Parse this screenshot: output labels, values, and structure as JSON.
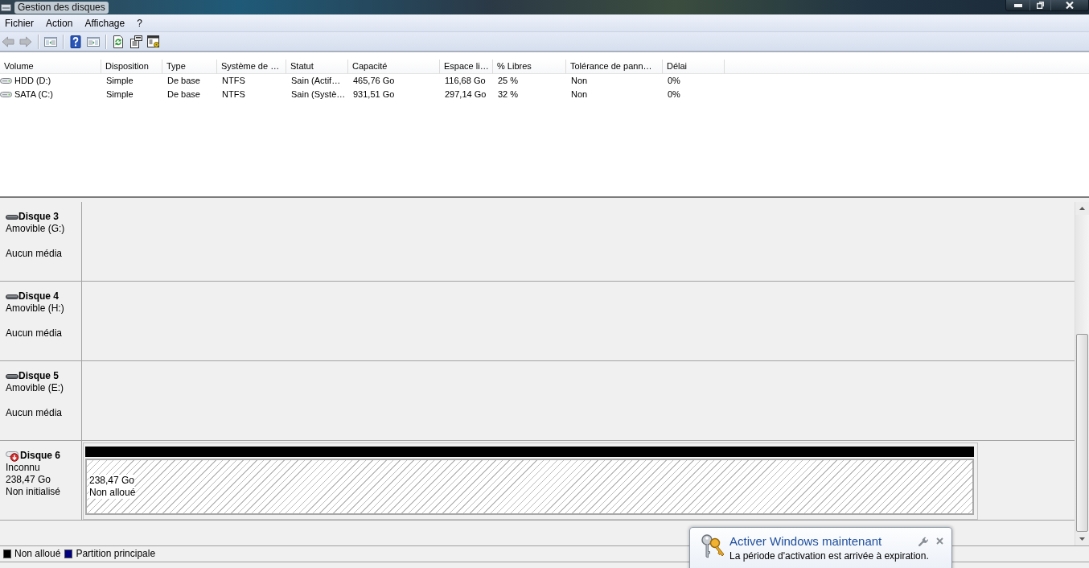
{
  "window": {
    "title": "Gestion des disques"
  },
  "menu": [
    "Fichier",
    "Action",
    "Affichage",
    "?"
  ],
  "toolbar": [
    {
      "buttons": [
        {
          "kind": "back",
          "disabled": true
        },
        {
          "kind": "forward",
          "disabled": true
        }
      ]
    },
    {
      "buttons": [
        {
          "kind": "console-tree",
          "disabled": false
        }
      ]
    },
    {
      "buttons": [
        {
          "kind": "help",
          "disabled": false
        },
        {
          "kind": "action-pane",
          "disabled": false
        }
      ]
    },
    {
      "buttons": [
        {
          "kind": "refresh",
          "disabled": false
        },
        {
          "kind": "properties",
          "disabled": false
        },
        {
          "kind": "settings",
          "disabled": false
        }
      ]
    }
  ],
  "table": {
    "columns": [
      "Volume",
      "Disposition",
      "Type",
      "Système de …",
      "Statut",
      "Capacité",
      "Espace li…",
      "% Libres",
      "Tolérance de pann…",
      "Délai"
    ],
    "rows": [
      {
        "cells": [
          "HDD (D:)",
          "Simple",
          "De base",
          "NTFS",
          "Sain (Actif…",
          "465,76 Go",
          "116,68 Go",
          "25 %",
          "Non",
          "0%"
        ]
      },
      {
        "cells": [
          "SATA (C:)",
          "Simple",
          "De base",
          "NTFS",
          "Sain (Systè…",
          "931,51 Go",
          "297,14 Go",
          "32 %",
          "Non",
          "0%"
        ]
      }
    ]
  },
  "disks": [
    {
      "kind": "removable",
      "name": "Disque 3",
      "type": "Amovible (G:)",
      "status": "Aucun média"
    },
    {
      "kind": "removable",
      "name": "Disque 4",
      "type": "Amovible (H:)",
      "status": "Aucun média"
    },
    {
      "kind": "removable",
      "name": "Disque 5",
      "type": "Amovible (E:)",
      "status": "Aucun média"
    },
    {
      "kind": "unknown",
      "name": "Disque 6",
      "type": "Inconnu",
      "size": "238,47 Go",
      "status": "Non initialisé",
      "partitions": [
        {
          "color": "#000000",
          "size": "238,47 Go",
          "label": "Non alloué"
        }
      ]
    }
  ],
  "legend": [
    {
      "label": "Non alloué",
      "color": "#000000"
    },
    {
      "label": "Partition principale",
      "color": "#000080"
    }
  ],
  "notification": {
    "title": "Activer Windows maintenant",
    "text": "La période d'activation est arrivée à expiration."
  }
}
